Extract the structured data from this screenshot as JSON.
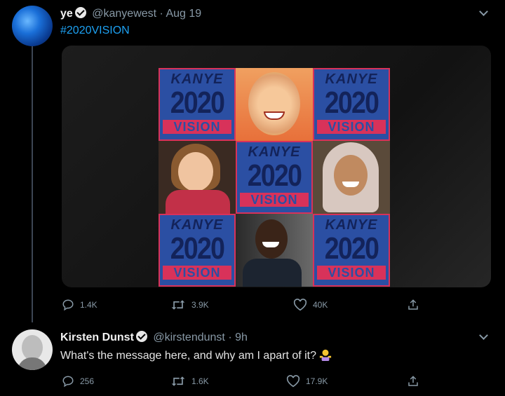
{
  "tweet1": {
    "name": "ye",
    "handle": "@kanyewest",
    "time": "· Aug 19",
    "text": "#2020VISION",
    "poster": {
      "top": "KANYE",
      "year": "2020",
      "bottom": "VISION"
    },
    "actions": {
      "replies": "1.4K",
      "retweets": "3.9K",
      "likes": "40K"
    }
  },
  "tweet2": {
    "name": "Kirsten Dunst",
    "handle": "@kirstendunst",
    "time": "· 9h",
    "text": "What's the message here, and why am I apart of it?",
    "actions": {
      "replies": "256",
      "retweets": "1.6K",
      "likes": "17.9K"
    }
  },
  "colors": {
    "background": "#000000",
    "link": "#1da1f2",
    "muted": "#8899a6",
    "poster_blue": "#2b4fa3",
    "poster_red": "#d8325a"
  },
  "icons": [
    "reply-icon",
    "retweet-icon",
    "like-icon",
    "share-icon",
    "verified-icon",
    "chevron-down-icon",
    "woman-shrugging-emoji"
  ]
}
